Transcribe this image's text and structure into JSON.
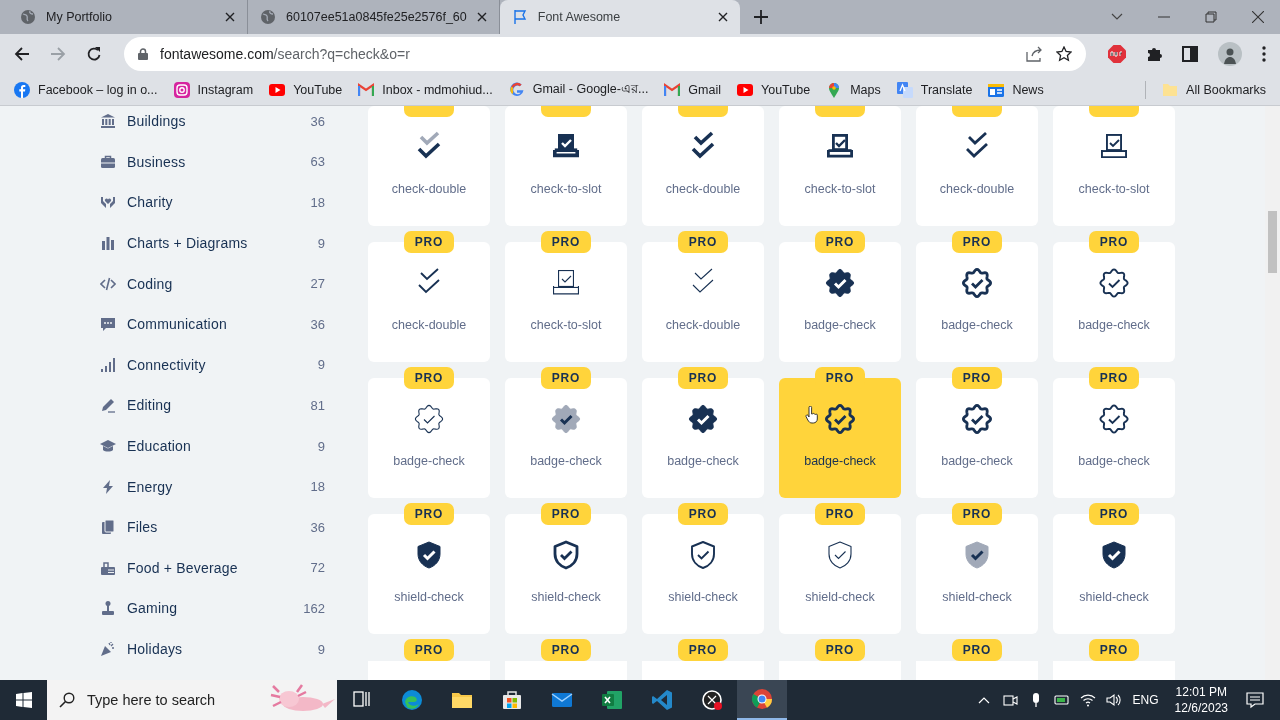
{
  "browser": {
    "tabs": [
      {
        "title": "My Portfolio",
        "selected": false
      },
      {
        "title": "60107ee51a0845fe25e2576f_60",
        "selected": false
      },
      {
        "title": "Font Awesome",
        "selected": true
      }
    ],
    "url": "fontawesome.com/search?q=check&o=r",
    "bookmarks": [
      {
        "label": "Facebook – log in o..."
      },
      {
        "label": "Instagram"
      },
      {
        "label": "YouTube"
      },
      {
        "label": "Inbox - mdmohiud..."
      },
      {
        "label": "Gmail - Google-এর..."
      },
      {
        "label": "Gmail"
      },
      {
        "label": "YouTube"
      },
      {
        "label": "Maps"
      },
      {
        "label": "Translate"
      },
      {
        "label": "News"
      }
    ],
    "all_bookmarks": "All Bookmarks"
  },
  "sidebar": {
    "categories": [
      {
        "name": "Buildings",
        "count": "36"
      },
      {
        "name": "Business",
        "count": "63"
      },
      {
        "name": "Charity",
        "count": "18"
      },
      {
        "name": "Charts + Diagrams",
        "count": "9"
      },
      {
        "name": "Coding",
        "count": "27"
      },
      {
        "name": "Communication",
        "count": "36"
      },
      {
        "name": "Connectivity",
        "count": "9"
      },
      {
        "name": "Editing",
        "count": "81"
      },
      {
        "name": "Education",
        "count": "9"
      },
      {
        "name": "Energy",
        "count": "18"
      },
      {
        "name": "Files",
        "count": "36"
      },
      {
        "name": "Food + Beverage",
        "count": "72"
      },
      {
        "name": "Gaming",
        "count": "162"
      },
      {
        "name": "Holidays",
        "count": "9"
      }
    ]
  },
  "results": [
    {
      "kind": "check-double",
      "label": "check-double",
      "badge_cut": true,
      "hovered": false
    },
    {
      "kind": "check-to-slot",
      "label": "check-to-slot",
      "badge_cut": true,
      "hovered": false
    },
    {
      "kind": "check-double",
      "label": "check-double",
      "badge_cut": true,
      "hovered": false
    },
    {
      "kind": "check-to-slot",
      "label": "check-to-slot",
      "badge_cut": true,
      "hovered": false
    },
    {
      "kind": "check-double",
      "label": "check-double",
      "badge_cut": true,
      "hovered": false
    },
    {
      "kind": "check-to-slot",
      "label": "check-to-slot",
      "badge_cut": true,
      "hovered": false
    },
    {
      "kind": "check-double",
      "label": "check-double",
      "badge": "PRO",
      "hovered": false
    },
    {
      "kind": "check-to-slot",
      "label": "check-to-slot",
      "badge": "PRO",
      "hovered": false
    },
    {
      "kind": "check-double",
      "label": "check-double",
      "badge": "PRO",
      "hovered": false
    },
    {
      "kind": "badge-check",
      "label": "badge-check",
      "badge": "PRO",
      "hovered": false
    },
    {
      "kind": "badge-check",
      "label": "badge-check",
      "badge": "PRO",
      "hovered": false
    },
    {
      "kind": "badge-check",
      "label": "badge-check",
      "badge": "PRO",
      "hovered": false
    },
    {
      "kind": "badge-check",
      "label": "badge-check",
      "badge": "PRO",
      "hovered": false
    },
    {
      "kind": "badge-check",
      "label": "badge-check",
      "badge": "PRO",
      "hovered": false
    },
    {
      "kind": "badge-check",
      "label": "badge-check",
      "badge": "PRO",
      "hovered": false
    },
    {
      "kind": "badge-check",
      "label": "badge-check",
      "badge": "PRO",
      "hovered": true
    },
    {
      "kind": "badge-check",
      "label": "badge-check",
      "badge": "PRO",
      "hovered": false
    },
    {
      "kind": "badge-check",
      "label": "badge-check",
      "badge": "PRO",
      "hovered": false
    },
    {
      "kind": "shield-check",
      "label": "shield-check",
      "badge": "PRO",
      "hovered": false
    },
    {
      "kind": "shield-check",
      "label": "shield-check",
      "badge": "PRO",
      "hovered": false
    },
    {
      "kind": "shield-check",
      "label": "shield-check",
      "badge": "PRO",
      "hovered": false
    },
    {
      "kind": "shield-check",
      "label": "shield-check",
      "badge": "PRO",
      "hovered": false
    },
    {
      "kind": "shield-check",
      "label": "shield-check",
      "badge": "PRO",
      "hovered": false
    },
    {
      "kind": "shield-check",
      "label": "shield-check",
      "badge": "PRO",
      "hovered": false
    },
    {
      "badge": "PRO",
      "hovered": false
    },
    {
      "badge": "PRO",
      "hovered": false
    },
    {
      "badge": "PRO",
      "hovered": false
    },
    {
      "badge": "PRO",
      "hovered": false
    },
    {
      "badge": "PRO",
      "hovered": false
    },
    {
      "badge": "PRO",
      "hovered": false
    }
  ],
  "taskbar": {
    "search_placeholder": "Type here to search",
    "language": "ENG",
    "time": "12:01 PM",
    "date": "12/6/2023"
  }
}
